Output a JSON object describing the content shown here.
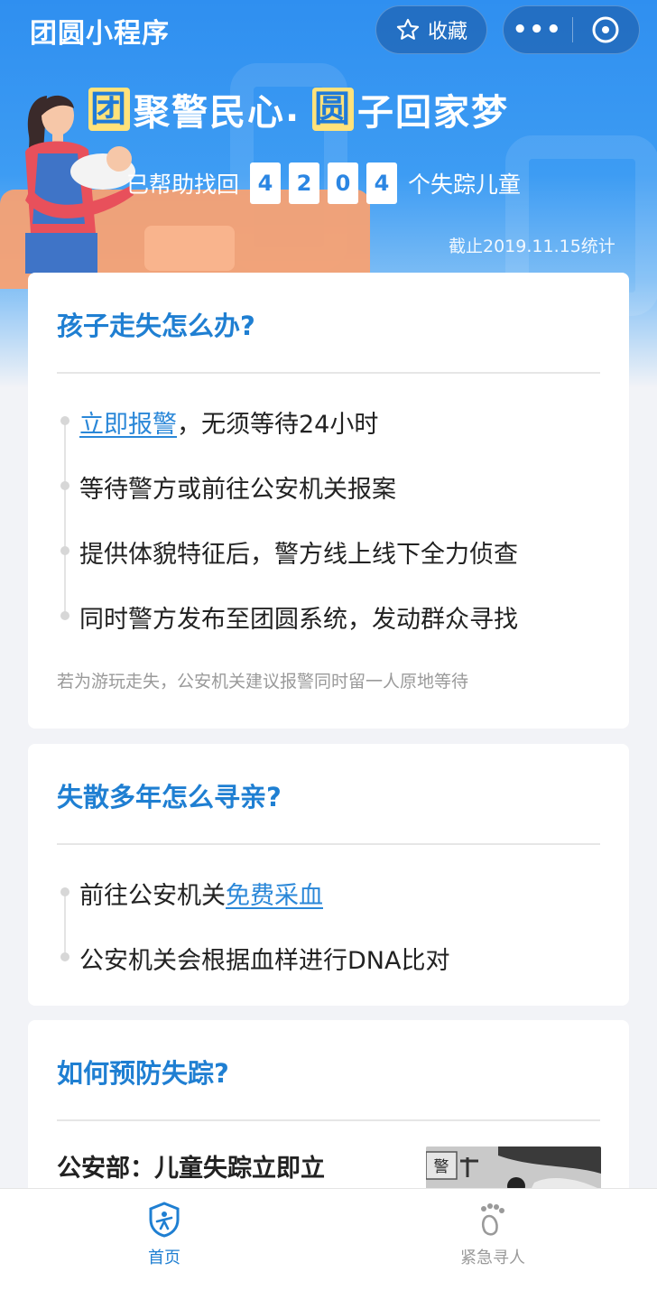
{
  "topbar": {
    "title": "团圆小程序",
    "favorite_label": "收藏",
    "more_label": "•••",
    "icons": {
      "favorite": "star-outline-icon",
      "more": "more-dots-icon",
      "close": "close-circle-icon"
    }
  },
  "banner": {
    "slogan_box1": "团",
    "slogan_part1": "聚警民心",
    "slogan_box2": "圆",
    "slogan_part2": "子回家梦",
    "stats_prefix": "已帮助找回",
    "digits": [
      "4",
      "2",
      "0",
      "4"
    ],
    "stats_suffix": "个失踪儿童",
    "cutoff": "截止2019.11.15统计"
  },
  "card_lost": {
    "title": "孩子走失怎么办?",
    "step1_link": "立即报警",
    "step1_rest": "，无须等待24小时",
    "step2": "等待警方或前往公安机关报案",
    "step3": "提供体貌特征后，警方线上线下全力侦查",
    "step4": "同时警方发布至团圆系统，发动群众寻找",
    "note": "若为游玩走失，公安机关建议报警同时留一人原地等待"
  },
  "card_family": {
    "title": "失散多年怎么寻亲?",
    "step1_text": "前往公安机关",
    "step1_link": "免费采血",
    "step2": "公安机关会根据血样进行DNA比对"
  },
  "card_prevent": {
    "title": "如何预防失踪?",
    "article_title": "公安部：儿童失踪立即立",
    "image_sign": "警"
  },
  "tabbar": {
    "home_label": "首页",
    "search_label": "紧急寻人",
    "active_color": "#1f7fd2",
    "inactive_color": "#9a9a9a"
  }
}
